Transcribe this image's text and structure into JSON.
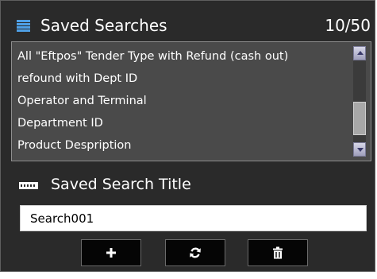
{
  "panel": {
    "title": "Saved Searches",
    "count": "10/50",
    "icon": "list-icon"
  },
  "saved_searches": {
    "items": [
      "All \"Eftpos\" Tender Type with Refund (cash out)",
      "refound with Dept ID",
      "Operator and Terminal",
      "Department ID",
      "Product Despription"
    ]
  },
  "title_section": {
    "label": "Saved Search Title",
    "icon": "keyboard-icon"
  },
  "title_input": {
    "value": "Search001"
  },
  "buttons": {
    "add_icon": "plus-icon",
    "refresh_icon": "refresh-icon",
    "delete_icon": "trash-icon"
  },
  "colors": {
    "panel_background": "#2a2a2a",
    "list_background": "#4a4a4a",
    "accent_blue": "#4fa0e6",
    "button_background": "#050505"
  }
}
